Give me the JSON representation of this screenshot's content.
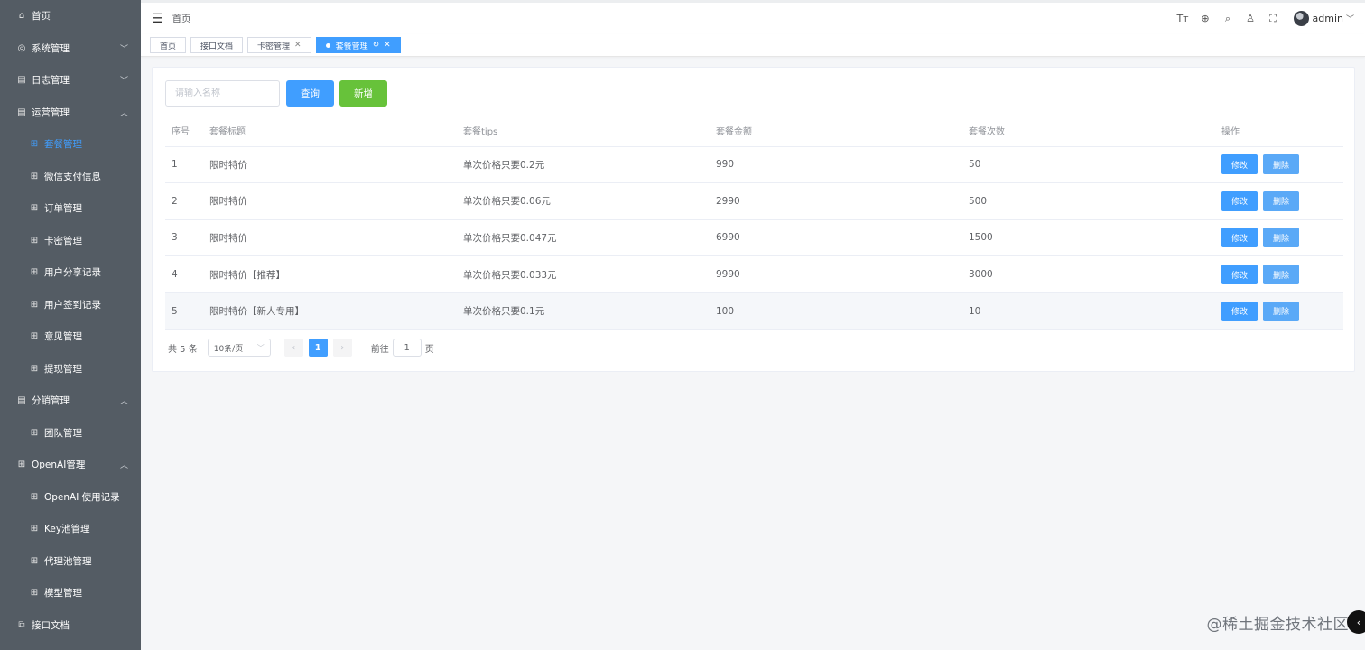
{
  "sidebar": {
    "items": [
      {
        "label": "首页",
        "icon": "home-icon",
        "glyph": "⌂",
        "sub": false,
        "arrow": ""
      },
      {
        "label": "系统管理",
        "icon": "gear-icon",
        "glyph": "◎",
        "sub": false,
        "arrow": "﹀"
      },
      {
        "label": "日志管理",
        "icon": "document-icon",
        "glyph": "▤",
        "sub": false,
        "arrow": "﹀"
      },
      {
        "label": "运营管理",
        "icon": "document-icon",
        "glyph": "▤",
        "sub": false,
        "arrow": "︿"
      },
      {
        "label": "套餐管理",
        "icon": "grid-icon",
        "glyph": "⊞",
        "sub": true,
        "arrow": "",
        "active": true
      },
      {
        "label": "微信支付信息",
        "icon": "grid-icon",
        "glyph": "⊞",
        "sub": true,
        "arrow": ""
      },
      {
        "label": "订单管理",
        "icon": "grid-icon",
        "glyph": "⊞",
        "sub": true,
        "arrow": ""
      },
      {
        "label": "卡密管理",
        "icon": "grid-icon",
        "glyph": "⊞",
        "sub": true,
        "arrow": ""
      },
      {
        "label": "用户分享记录",
        "icon": "grid-icon",
        "glyph": "⊞",
        "sub": true,
        "arrow": ""
      },
      {
        "label": "用户签到记录",
        "icon": "grid-icon",
        "glyph": "⊞",
        "sub": true,
        "arrow": ""
      },
      {
        "label": "意见管理",
        "icon": "grid-icon",
        "glyph": "⊞",
        "sub": true,
        "arrow": ""
      },
      {
        "label": "提现管理",
        "icon": "grid-icon",
        "glyph": "⊞",
        "sub": true,
        "arrow": ""
      },
      {
        "label": "分销管理",
        "icon": "document-icon",
        "glyph": "▤",
        "sub": false,
        "arrow": "︿"
      },
      {
        "label": "团队管理",
        "icon": "grid-icon",
        "glyph": "⊞",
        "sub": true,
        "arrow": ""
      },
      {
        "label": "OpenAI管理",
        "icon": "grid-icon",
        "glyph": "⊞",
        "sub": false,
        "arrow": "︿"
      },
      {
        "label": "OpenAI 使用记录",
        "icon": "grid-icon",
        "glyph": "⊞",
        "sub": true,
        "arrow": ""
      },
      {
        "label": "Key池管理",
        "icon": "grid-icon",
        "glyph": "⊞",
        "sub": true,
        "arrow": ""
      },
      {
        "label": "代理池管理",
        "icon": "grid-icon",
        "glyph": "⊞",
        "sub": true,
        "arrow": ""
      },
      {
        "label": "模型管理",
        "icon": "grid-icon",
        "glyph": "⊞",
        "sub": true,
        "arrow": ""
      },
      {
        "label": "接口文档",
        "icon": "external-link-icon",
        "glyph": "⧉",
        "sub": false,
        "arrow": ""
      }
    ]
  },
  "header": {
    "breadcrumb": "首页",
    "user": "admin"
  },
  "tags": [
    {
      "label": "首页",
      "closable": false,
      "active": false
    },
    {
      "label": "接口文档",
      "closable": false,
      "active": false
    },
    {
      "label": "卡密管理",
      "closable": true,
      "active": false
    },
    {
      "label": "套餐管理",
      "closable": true,
      "active": true
    }
  ],
  "toolbar": {
    "search_placeholder": "请输入名称",
    "query_label": "查询",
    "add_label": "新增"
  },
  "table": {
    "columns": [
      "序号",
      "套餐标题",
      "套餐tips",
      "套餐金额",
      "套餐次数",
      "操作"
    ],
    "rows": [
      [
        "1",
        "限时特价",
        "单次价格只要0.2元",
        "990",
        "50"
      ],
      [
        "2",
        "限时特价",
        "单次价格只要0.06元",
        "2990",
        "500"
      ],
      [
        "3",
        "限时特价",
        "单次价格只要0.047元",
        "6990",
        "1500"
      ],
      [
        "4",
        "限时特价【推荐】",
        "单次价格只要0.033元",
        "9990",
        "3000"
      ],
      [
        "5",
        "限时特价【新人专用】",
        "单次价格只要0.1元",
        "100",
        "10"
      ]
    ],
    "edit_label": "修改",
    "delete_label": "删除"
  },
  "pagination": {
    "total": "共 5 条",
    "page_size": "10条/页",
    "current_page": "1",
    "goto_label": "前往",
    "goto_value": "1",
    "goto_suffix": "页"
  },
  "watermark": "@稀土掘金技术社区",
  "colors": {
    "primary": "#409eff",
    "success": "#67c23a",
    "sidebar_bg": "#545c64"
  }
}
